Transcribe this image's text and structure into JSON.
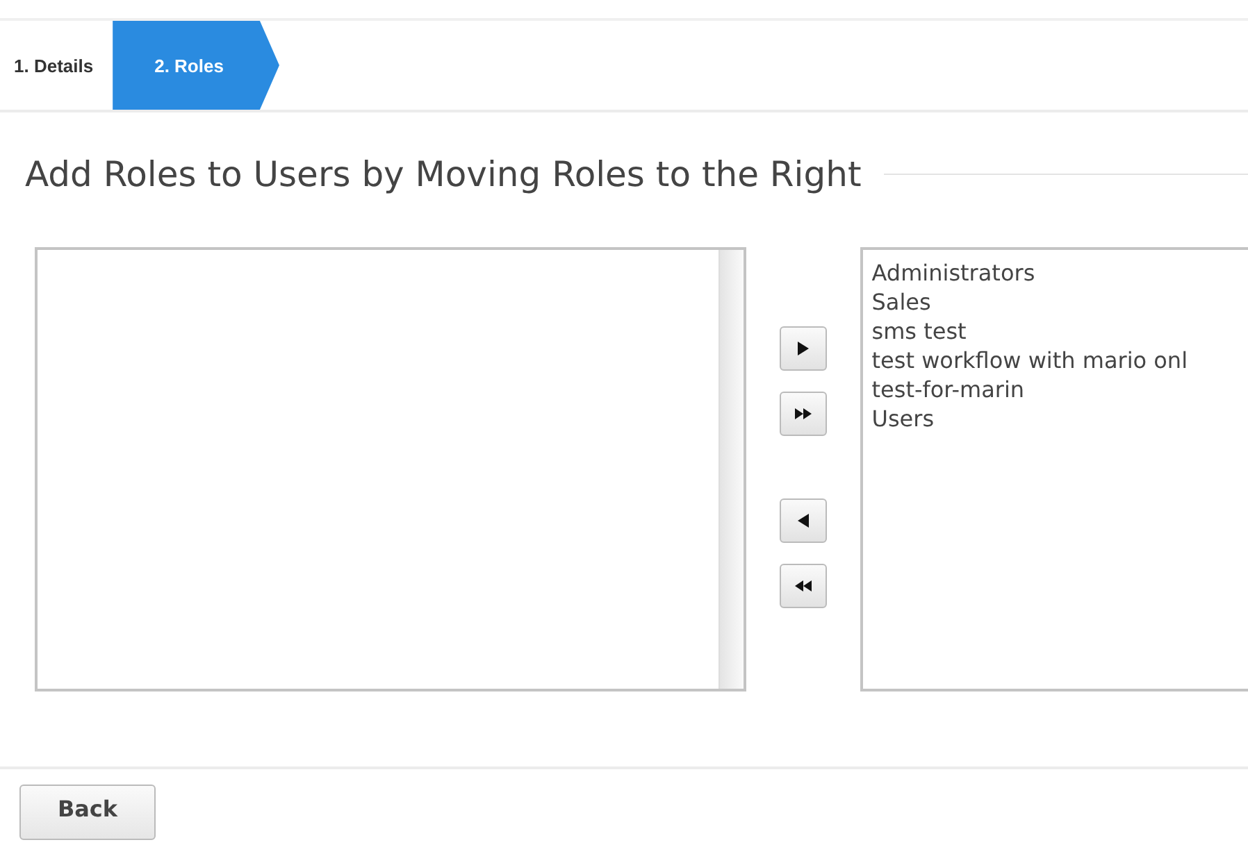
{
  "steps": [
    {
      "label": "1. Details",
      "selected": false
    },
    {
      "label": "2. Roles",
      "selected": true
    }
  ],
  "heading": "Add Roles to Users by Moving Roles to the Right",
  "move_buttons": [
    {
      "kind": "move-right"
    },
    {
      "kind": "move-all-right"
    },
    {
      "kind": "move-left"
    },
    {
      "kind": "move-all-left"
    }
  ],
  "assigned_roles": [
    "Administrators",
    "Sales",
    "sms test",
    "test workflow with mario onl",
    "test-for-marin",
    "Users"
  ],
  "buttons": [
    "Back"
  ]
}
